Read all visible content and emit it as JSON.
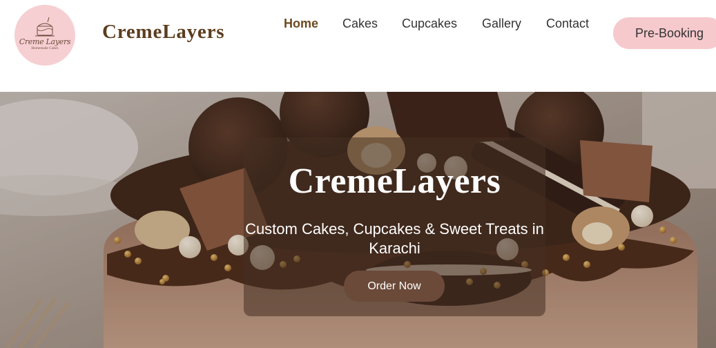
{
  "logo": {
    "script_text": "Creme Layers",
    "subtitle": "Homemade Cakes",
    "bg_color": "#f6cfd2"
  },
  "brand": {
    "name": "CremeLayers",
    "color": "#5c3d1e"
  },
  "nav": {
    "items": [
      {
        "label": "Home",
        "active": true
      },
      {
        "label": "Cakes",
        "active": false
      },
      {
        "label": "Cupcakes",
        "active": false
      },
      {
        "label": "Gallery",
        "active": false
      },
      {
        "label": "Contact",
        "active": false
      }
    ],
    "prebooking_label": "Pre-Booking"
  },
  "hero": {
    "title": "CremeLayers",
    "subtitle": "Custom Cakes, Cupcakes & Sweet Treats in Karachi",
    "cta_label": "Order Now",
    "cta_color": "#6b4a3a"
  },
  "colors": {
    "accent_pink": "#f6c9cc",
    "accent_brown": "#6b4a1f"
  }
}
